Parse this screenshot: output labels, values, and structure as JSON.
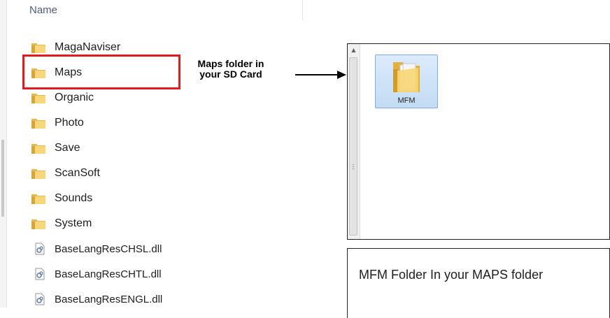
{
  "left_pane": {
    "column_header": "Name",
    "folders": [
      {
        "label": "MagaNaviser",
        "icon": "folder-icon"
      },
      {
        "label": "Maps",
        "icon": "folder-icon"
      },
      {
        "label": "Organic",
        "icon": "folder-icon"
      },
      {
        "label": "Photo",
        "icon": "folder-icon"
      },
      {
        "label": "Save",
        "icon": "folder-icon"
      },
      {
        "label": "ScanSoft",
        "icon": "folder-icon"
      },
      {
        "label": "Sounds",
        "icon": "folder-icon"
      },
      {
        "label": "System",
        "icon": "folder-icon"
      }
    ],
    "files": [
      {
        "label": "BaseLangResCHSL.dll",
        "icon": "dll-file-icon"
      },
      {
        "label": "BaseLangResCHTL.dll",
        "icon": "dll-file-icon"
      },
      {
        "label": "BaseLangResENGL.dll",
        "icon": "dll-file-icon"
      }
    ]
  },
  "annotation": {
    "callout_line1": "Maps folder in",
    "callout_line2": "your SD Card",
    "highlight_color": "#e11b22"
  },
  "right_window": {
    "folder_label": "MFM",
    "folder_icon": "folder-icon",
    "selection_color": "#c2dcf3"
  },
  "caption": {
    "text": "MFM Folder In your MAPS folder"
  }
}
